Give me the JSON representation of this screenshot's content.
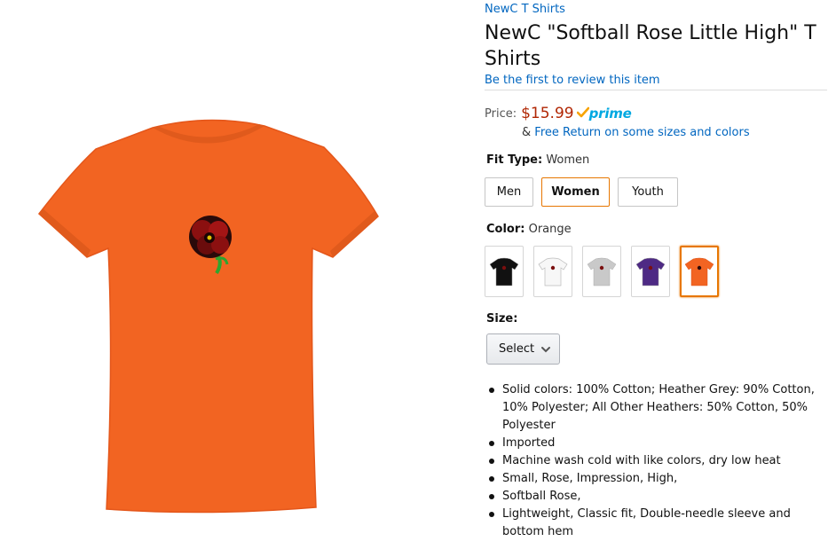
{
  "product": {
    "brand": "NewC T Shirts",
    "title": "NewC \"Softball Rose Little High\" T Shirts",
    "review_link": "Be the first to review this item",
    "image_color": "#f26422"
  },
  "price": {
    "label": "Price:",
    "value": "$15.99",
    "prime": "prime",
    "return_prefix": "&",
    "return_link": "Free Return on some sizes and colors"
  },
  "fit_type": {
    "label": "Fit Type:",
    "selected": "Women",
    "options": [
      "Men",
      "Women",
      "Youth"
    ]
  },
  "color": {
    "label": "Color:",
    "selected": "Orange",
    "swatches": [
      {
        "color": "#111111"
      },
      {
        "color": "#f7f7f7"
      },
      {
        "color": "#c9c9c9"
      },
      {
        "color": "#4e2a84"
      },
      {
        "color": "#f26422"
      }
    ]
  },
  "size": {
    "label": "Size:",
    "select_value": "Select"
  },
  "features": [
    "Solid colors: 100% Cotton; Heather Grey: 90% Cotton, 10% Polyester; All Other Heathers: 50% Cotton, 50% Polyester",
    "Imported",
    "Machine wash cold with like colors, dry low heat",
    "Small, Rose, Impression, High,",
    "Softball Rose,",
    "Lightweight, Classic fit, Double-needle sleeve and bottom hem"
  ],
  "colors": {
    "link": "#0066c0",
    "price": "#b12704",
    "accent": "#e77600",
    "prime": "#00a8e1"
  }
}
